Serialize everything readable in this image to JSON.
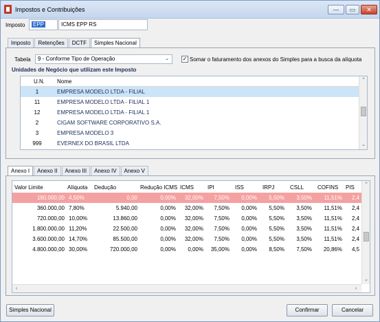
{
  "window": {
    "title": "Impostos e Contribuições",
    "min_glyph": "—",
    "restore_glyph": "▭",
    "close_glyph": "✕"
  },
  "imposto": {
    "label": "Imposto",
    "code": "EPP",
    "description": "ICMS EPP RS"
  },
  "main_tabs": [
    "Imposto",
    "Retenções",
    "DCTF",
    "Simples Nacional"
  ],
  "tabela": {
    "label": "Tabela",
    "value": "9 - Conforme Tipo de Operação",
    "arrow": "⌄"
  },
  "somar": {
    "label": "Somar o faturamento dos anexos do Simples para a busca da alíquota",
    "checked": "✓"
  },
  "unidades": {
    "title": "Unidades de Negócio que utilizam este Imposto",
    "headers": [
      "U.N.",
      "Nome"
    ],
    "rows": [
      {
        "un": "1",
        "nome": "EMPRESA MODELO LTDA - FILIAL"
      },
      {
        "un": "11",
        "nome": "EMPRESA MODELO LTDA - FILIAL 1"
      },
      {
        "un": "12",
        "nome": "EMPRESA MODELO LTDA - FILIAL 1"
      },
      {
        "un": "2",
        "nome": "CIGAM SOFTWARE CORPORATIVO S.A."
      },
      {
        "un": "3",
        "nome": "EMPRESA MODELO 3"
      },
      {
        "un": "999",
        "nome": "EVERNEX DO BRASIL LTDA"
      }
    ]
  },
  "anexo_tabs": [
    "Anexo I",
    "Anexo II",
    "Anexo III",
    "Anexo IV",
    "Anexo V"
  ],
  "anexo": {
    "headers": [
      "Valor Limite",
      "Alíquota",
      "Dedução",
      "Redução ICMS",
      "ICMS",
      "IPI",
      "ISS",
      "IRPJ",
      "CSLL",
      "COFINS",
      "PIS"
    ],
    "rows": [
      [
        "180.000,00",
        "4,50%",
        "0,00",
        "0,00%",
        "32,00%",
        "7,50%",
        "0,00%",
        "5,50%",
        "3,50%",
        "11,51%",
        "2,4"
      ],
      [
        "360.000,00",
        "7,80%",
        "5.940,00",
        "0,00%",
        "32,00%",
        "7,50%",
        "0,00%",
        "5,50%",
        "3,50%",
        "11,51%",
        "2,4"
      ],
      [
        "720.000,00",
        "10,00%",
        "13.860,00",
        "0,00%",
        "32,00%",
        "7,50%",
        "0,00%",
        "5,50%",
        "3,50%",
        "11,51%",
        "2,4"
      ],
      [
        "1.800.000,00",
        "11,20%",
        "22.500,00",
        "0,00%",
        "32,00%",
        "7,50%",
        "0,00%",
        "5,50%",
        "3,50%",
        "11,51%",
        "2,4"
      ],
      [
        "3.600.000,00",
        "14,70%",
        "85.500,00",
        "0,00%",
        "32,00%",
        "7,50%",
        "0,00%",
        "5,50%",
        "3,50%",
        "11,51%",
        "2,4"
      ],
      [
        "4.800.000,00",
        "30,00%",
        "720.000,00",
        "0,00%",
        "0,00%",
        "35,00%",
        "0,00%",
        "8,50%",
        "7,50%",
        "20,86%",
        "4,5"
      ]
    ]
  },
  "buttons": {
    "simples": "Simples Nacional",
    "confirmar": "Confirmar",
    "cancelar": "Cancelar"
  },
  "scroll": {
    "up": "⌃",
    "down": "⌄",
    "left": "‹",
    "right": "›"
  },
  "colors": {
    "selected_row": "#cce4f7",
    "highlight_row": "#f4a1a1"
  }
}
